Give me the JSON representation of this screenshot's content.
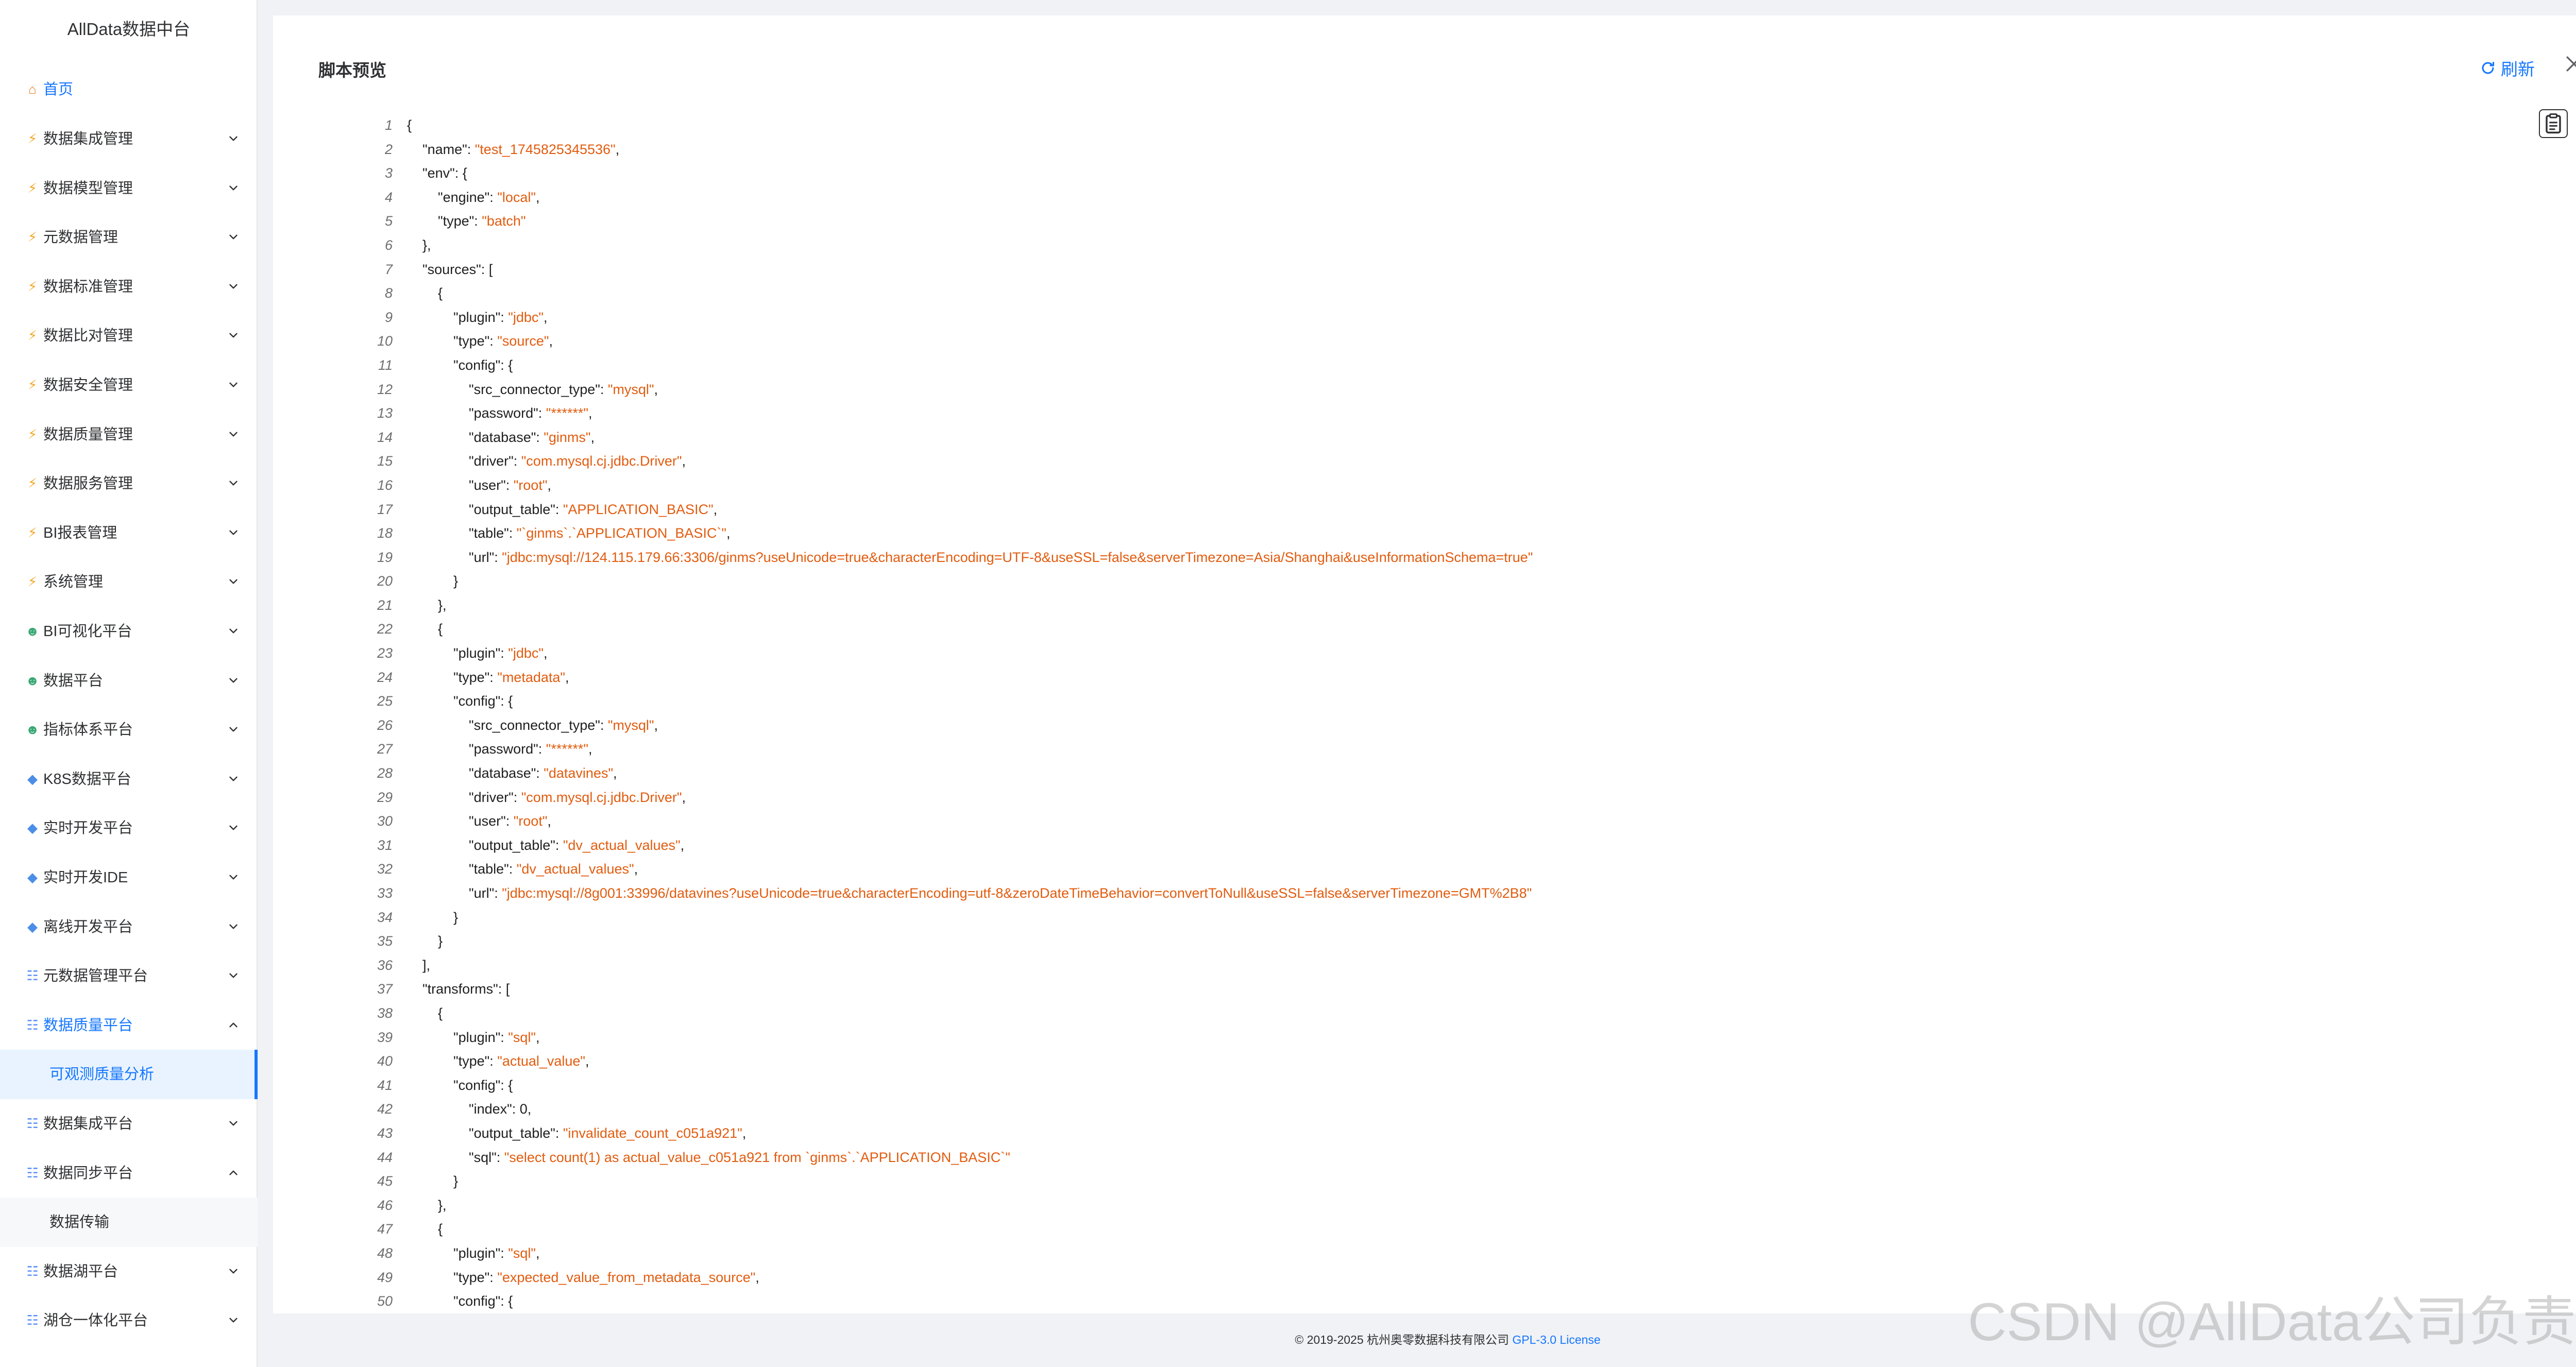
{
  "sidebar": {
    "brand": "AllData数据中台",
    "home": "首页",
    "items": [
      {
        "label": "数据集成管理",
        "icon": "bolt-icon",
        "state": "collapsed"
      },
      {
        "label": "数据模型管理",
        "icon": "bolt-icon",
        "state": "collapsed"
      },
      {
        "label": "元数据管理",
        "icon": "bolt-icon",
        "state": "collapsed"
      },
      {
        "label": "数据标准管理",
        "icon": "bolt-icon",
        "state": "collapsed"
      },
      {
        "label": "数据比对管理",
        "icon": "bolt-icon",
        "state": "collapsed"
      },
      {
        "label": "数据安全管理",
        "icon": "bolt-icon",
        "state": "collapsed"
      },
      {
        "label": "数据质量管理",
        "icon": "bolt-icon",
        "state": "collapsed"
      },
      {
        "label": "数据服务管理",
        "icon": "bolt-icon",
        "state": "collapsed"
      },
      {
        "label": "BI报表管理",
        "icon": "bolt-icon",
        "state": "collapsed"
      },
      {
        "label": "系统管理",
        "icon": "bolt-icon",
        "state": "collapsed"
      },
      {
        "label": "BI可视化平台",
        "icon": "user-icon",
        "state": "collapsed"
      },
      {
        "label": "数据平台",
        "icon": "user-icon",
        "state": "collapsed"
      },
      {
        "label": "指标体系平台",
        "icon": "user-icon",
        "state": "collapsed"
      },
      {
        "label": "K8S数据平台",
        "icon": "gem-icon",
        "state": "collapsed"
      },
      {
        "label": "实时开发平台",
        "icon": "gem-icon",
        "state": "collapsed"
      },
      {
        "label": "实时开发IDE",
        "icon": "gem-icon",
        "state": "collapsed"
      },
      {
        "label": "离线开发平台",
        "icon": "gem-icon",
        "state": "collapsed"
      },
      {
        "label": "元数据管理平台",
        "icon": "grid-icon",
        "state": "collapsed"
      },
      {
        "label": "数据质量平台",
        "icon": "grid-icon",
        "state": "expanded"
      },
      {
        "label": "可观测质量分析",
        "icon": "",
        "state": "sub-selected"
      },
      {
        "label": "数据集成平台",
        "icon": "grid-icon",
        "state": "collapsed"
      },
      {
        "label": "数据同步平台",
        "icon": "grid-icon",
        "state": "expanded-plain"
      },
      {
        "label": "数据传输",
        "icon": "",
        "state": "sub"
      },
      {
        "label": "数据湖平台",
        "icon": "grid-icon",
        "state": "collapsed"
      },
      {
        "label": "湖仓一体化平台",
        "icon": "grid-icon",
        "state": "collapsed"
      }
    ]
  },
  "panel": {
    "title": "脚本预览",
    "refresh_label": "刷新"
  },
  "code_lines": [
    [
      [
        "{",
        "p"
      ]
    ],
    [
      [
        "    \"name\": ",
        "p"
      ],
      [
        "\"test_1745825345536\"",
        "s"
      ],
      [
        ",",
        "p"
      ]
    ],
    [
      [
        "    \"env\": {",
        "p"
      ]
    ],
    [
      [
        "        \"engine\": ",
        "p"
      ],
      [
        "\"local\"",
        "s"
      ],
      [
        ",",
        "p"
      ]
    ],
    [
      [
        "        \"type\": ",
        "p"
      ],
      [
        "\"batch\"",
        "s"
      ]
    ],
    [
      [
        "    },",
        "p"
      ]
    ],
    [
      [
        "    \"sources\": [",
        "p"
      ]
    ],
    [
      [
        "        {",
        "p"
      ]
    ],
    [
      [
        "            \"plugin\": ",
        "p"
      ],
      [
        "\"jdbc\"",
        "s"
      ],
      [
        ",",
        "p"
      ]
    ],
    [
      [
        "            \"type\": ",
        "p"
      ],
      [
        "\"source\"",
        "s"
      ],
      [
        ",",
        "p"
      ]
    ],
    [
      [
        "            \"config\": {",
        "p"
      ]
    ],
    [
      [
        "                \"src_connector_type\": ",
        "p"
      ],
      [
        "\"mysql\"",
        "s"
      ],
      [
        ",",
        "p"
      ]
    ],
    [
      [
        "                \"password\": ",
        "p"
      ],
      [
        "\"******\"",
        "s"
      ],
      [
        ",",
        "p"
      ]
    ],
    [
      [
        "                \"database\": ",
        "p"
      ],
      [
        "\"ginms\"",
        "s"
      ],
      [
        ",",
        "p"
      ]
    ],
    [
      [
        "                \"driver\": ",
        "p"
      ],
      [
        "\"com.mysql.cj.jdbc.Driver\"",
        "s"
      ],
      [
        ",",
        "p"
      ]
    ],
    [
      [
        "                \"user\": ",
        "p"
      ],
      [
        "\"root\"",
        "s"
      ],
      [
        ",",
        "p"
      ]
    ],
    [
      [
        "                \"output_table\": ",
        "p"
      ],
      [
        "\"APPLICATION_BASIC\"",
        "s"
      ],
      [
        ",",
        "p"
      ]
    ],
    [
      [
        "                \"table\": ",
        "p"
      ],
      [
        "\"`ginms`.`APPLICATION_BASIC`\"",
        "s"
      ],
      [
        ",",
        "p"
      ]
    ],
    [
      [
        "                \"url\": ",
        "p"
      ],
      [
        "\"jdbc:mysql://124.115.179.66:3306/ginms?useUnicode=true&characterEncoding=UTF-8&useSSL=false&serverTimezone=Asia/Shanghai&useInformationSchema=true\"",
        "s"
      ]
    ],
    [
      [
        "            }",
        "p"
      ]
    ],
    [
      [
        "        },",
        "p"
      ]
    ],
    [
      [
        "        {",
        "p"
      ]
    ],
    [
      [
        "            \"plugin\": ",
        "p"
      ],
      [
        "\"jdbc\"",
        "s"
      ],
      [
        ",",
        "p"
      ]
    ],
    [
      [
        "            \"type\": ",
        "p"
      ],
      [
        "\"metadata\"",
        "s"
      ],
      [
        ",",
        "p"
      ]
    ],
    [
      [
        "            \"config\": {",
        "p"
      ]
    ],
    [
      [
        "                \"src_connector_type\": ",
        "p"
      ],
      [
        "\"mysql\"",
        "s"
      ],
      [
        ",",
        "p"
      ]
    ],
    [
      [
        "                \"password\": ",
        "p"
      ],
      [
        "\"******\"",
        "s"
      ],
      [
        ",",
        "p"
      ]
    ],
    [
      [
        "                \"database\": ",
        "p"
      ],
      [
        "\"datavines\"",
        "s"
      ],
      [
        ",",
        "p"
      ]
    ],
    [
      [
        "                \"driver\": ",
        "p"
      ],
      [
        "\"com.mysql.cj.jdbc.Driver\"",
        "s"
      ],
      [
        ",",
        "p"
      ]
    ],
    [
      [
        "                \"user\": ",
        "p"
      ],
      [
        "\"root\"",
        "s"
      ],
      [
        ",",
        "p"
      ]
    ],
    [
      [
        "                \"output_table\": ",
        "p"
      ],
      [
        "\"dv_actual_values\"",
        "s"
      ],
      [
        ",",
        "p"
      ]
    ],
    [
      [
        "                \"table\": ",
        "p"
      ],
      [
        "\"dv_actual_values\"",
        "s"
      ],
      [
        ",",
        "p"
      ]
    ],
    [
      [
        "                \"url\": ",
        "p"
      ],
      [
        "\"jdbc:mysql://8g001:33996/datavines?useUnicode=true&characterEncoding=utf-8&zeroDateTimeBehavior=convertToNull&useSSL=false&serverTimezone=GMT%2B8\"",
        "s"
      ]
    ],
    [
      [
        "            }",
        "p"
      ]
    ],
    [
      [
        "        }",
        "p"
      ]
    ],
    [
      [
        "    ],",
        "p"
      ]
    ],
    [
      [
        "    \"transforms\": [",
        "p"
      ]
    ],
    [
      [
        "        {",
        "p"
      ]
    ],
    [
      [
        "            \"plugin\": ",
        "p"
      ],
      [
        "\"sql\"",
        "s"
      ],
      [
        ",",
        "p"
      ]
    ],
    [
      [
        "            \"type\": ",
        "p"
      ],
      [
        "\"actual_value\"",
        "s"
      ],
      [
        ",",
        "p"
      ]
    ],
    [
      [
        "            \"config\": {",
        "p"
      ]
    ],
    [
      [
        "                \"index\": 0,",
        "p"
      ]
    ],
    [
      [
        "                \"output_table\": ",
        "p"
      ],
      [
        "\"invalidate_count_c051a921\"",
        "s"
      ],
      [
        ",",
        "p"
      ]
    ],
    [
      [
        "                \"sql\": ",
        "p"
      ],
      [
        "\"select count(1) as actual_value_c051a921 from `ginms`.`APPLICATION_BASIC`\"",
        "s"
      ]
    ],
    [
      [
        "            }",
        "p"
      ]
    ],
    [
      [
        "        },",
        "p"
      ]
    ],
    [
      [
        "        {",
        "p"
      ]
    ],
    [
      [
        "            \"plugin\": ",
        "p"
      ],
      [
        "\"sql\"",
        "s"
      ],
      [
        ",",
        "p"
      ]
    ],
    [
      [
        "            \"type\": ",
        "p"
      ],
      [
        "\"expected_value_from_metadata_source\"",
        "s"
      ],
      [
        ",",
        "p"
      ]
    ],
    [
      [
        "            \"config\": {",
        "p"
      ]
    ]
  ],
  "footer": {
    "copyright": "© 2019-2025 杭州奥零数据科技有限公司",
    "license": "GPL-3.0 License"
  },
  "watermark": "CSDN @AllData公司负责人",
  "colors": {
    "accent": "#1677ff",
    "string": "#e25c0f",
    "background": "#f0f2f5"
  }
}
